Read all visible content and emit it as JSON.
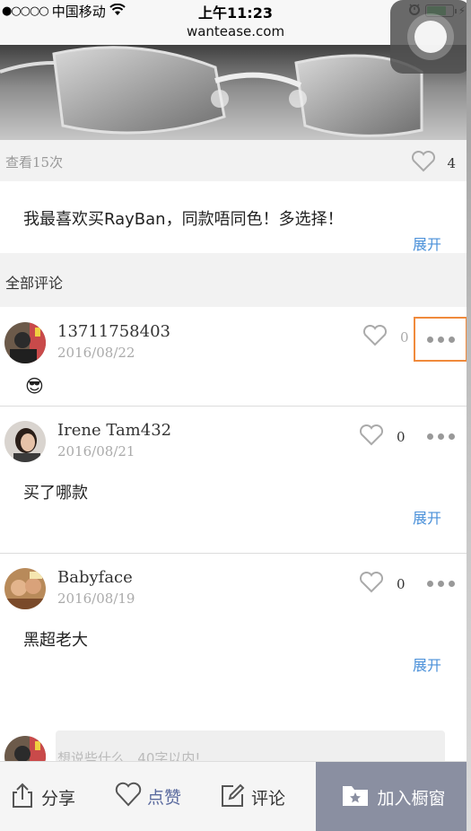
{
  "status_bar": {
    "signal": "●○○○○",
    "carrier": "中国移动",
    "time": "上午11:23"
  },
  "url": "wantease.com",
  "post": {
    "views": "查看15次",
    "likes": "4",
    "text": "我最喜欢买RayBan，同款唔同色！多选择！",
    "expand": "展开"
  },
  "comments_title": "全部评论",
  "comments": [
    {
      "name": "13711758403",
      "date": "2016/08/22",
      "likes": "0",
      "body": "😎",
      "expand": ""
    },
    {
      "name": "Irene Tam432",
      "date": "2016/08/21",
      "likes": "0",
      "body": "买了哪款",
      "expand": "展开"
    },
    {
      "name": "Babyface",
      "date": "2016/08/19",
      "likes": "0",
      "body": "黑超老大",
      "expand": "展开"
    }
  ],
  "composer": {
    "placeholder": "想说些什么...40字以内!"
  },
  "bottom_bar": {
    "share": "分享",
    "like": "点赞",
    "comment": "评论",
    "add": "加入橱窗"
  },
  "colors": {
    "link": "#4a90d9",
    "highlight": "#f08a3c",
    "add_button_bg": "#8a8fa1"
  },
  "icons": [
    "wifi-icon",
    "alarm-icon",
    "battery-icon",
    "heart-icon",
    "more-icon",
    "share-icon",
    "edit-icon",
    "folder-star-icon"
  ]
}
